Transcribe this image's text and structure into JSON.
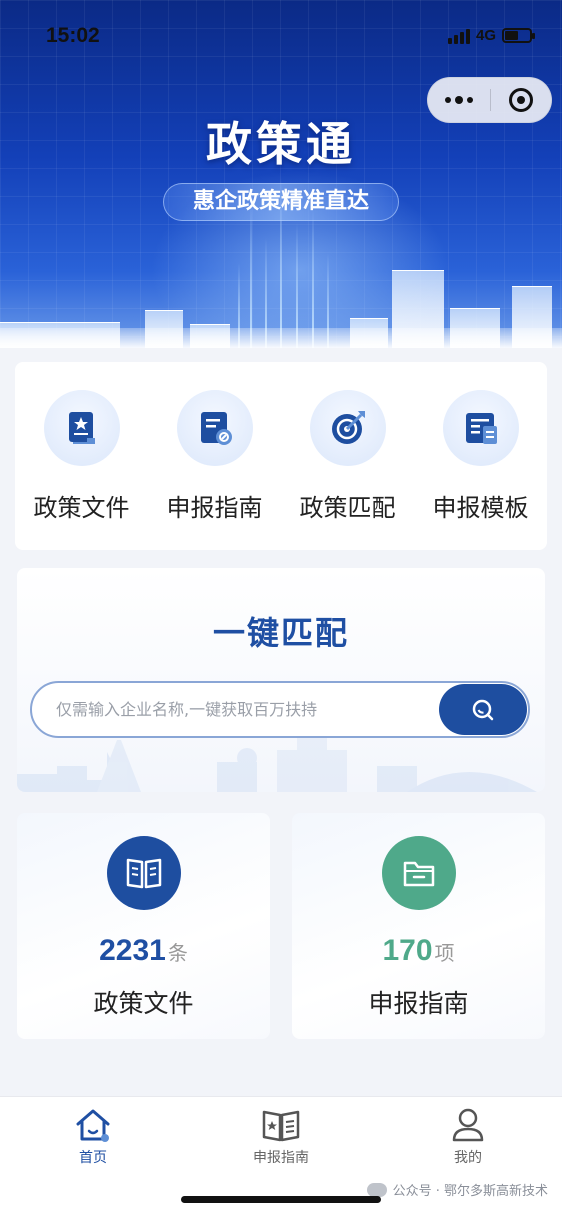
{
  "status_bar": {
    "time": "15:02",
    "network": "4G"
  },
  "header": {
    "title": "政策通",
    "subtitle": "惠企政策精准直达"
  },
  "quick_menu": {
    "items": [
      {
        "label": "政策文件",
        "icon": "policy-document-icon"
      },
      {
        "label": "申报指南",
        "icon": "application-guide-icon"
      },
      {
        "label": "政策匹配",
        "icon": "target-match-icon"
      },
      {
        "label": "申报模板",
        "icon": "template-icon"
      }
    ]
  },
  "match": {
    "title": "一键匹配",
    "search_placeholder": "仅需输入企业名称,一键获取百万扶持",
    "search_value": ""
  },
  "stats": {
    "policies": {
      "count": "2231",
      "unit": "条",
      "label": "政策文件"
    },
    "guides": {
      "count": "170",
      "unit": "项",
      "label": "申报指南"
    }
  },
  "tabbar": {
    "items": [
      {
        "label": "首页",
        "active": true
      },
      {
        "label": "申报指南",
        "active": false
      },
      {
        "label": "我的",
        "active": false
      }
    ]
  },
  "watermark": {
    "text": "公众号 · 鄂尔多斯高新技术"
  },
  "colors": {
    "primary": "#1e4ea0",
    "accent_green": "#4fa98a",
    "banner_top": "#0b2a86",
    "page_bg": "#f2f4f9"
  }
}
